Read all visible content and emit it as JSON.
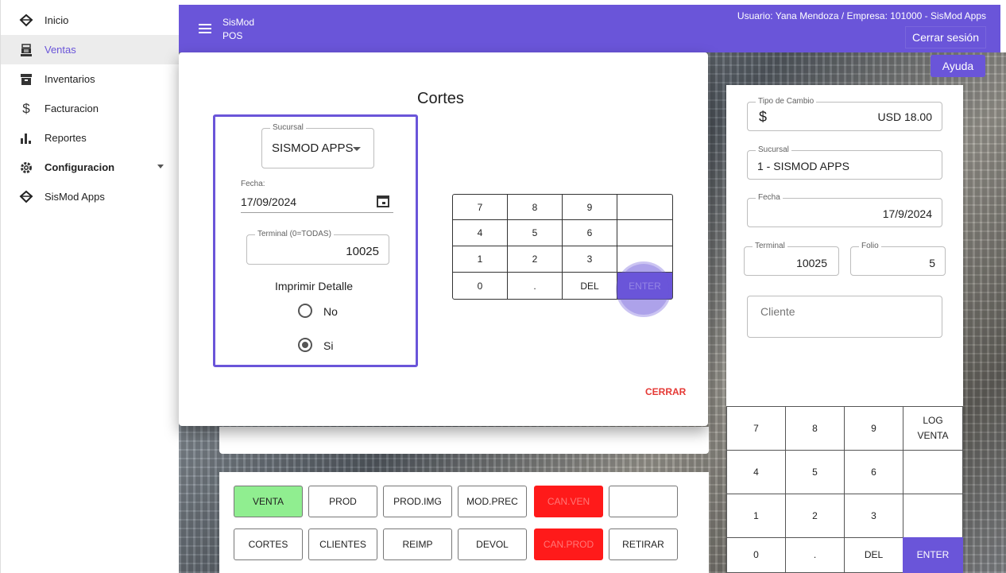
{
  "sidebar": {
    "items": [
      {
        "label": "Inicio",
        "icon": "logo-diamond-icon"
      },
      {
        "label": "Ventas",
        "icon": "cash-register-icon"
      },
      {
        "label": "Inventarios",
        "icon": "archive-icon"
      },
      {
        "label": "Facturacion",
        "icon": "dollar-icon"
      },
      {
        "label": "Reportes",
        "icon": "bar-chart-icon"
      },
      {
        "label": "Configuracion",
        "icon": "gear-icon"
      },
      {
        "label": "SisMod Apps",
        "icon": "logo-diamond-icon"
      }
    ],
    "active": "Ventas"
  },
  "header": {
    "app_name": "SisMod",
    "app_sub": "POS",
    "user_info": "Usuario: Yana Mendoza / Empresa: 101000 - SisMod Apps",
    "logout_label": "Cerrar sesión",
    "help_label": "Ayuda"
  },
  "colors": {
    "accent": "#6a55d9",
    "green_button": "#90ee90",
    "red_button": "#ff1a1a",
    "close_red": "#e53935"
  },
  "dialog": {
    "title": "Cortes",
    "sucursal_label": "Sucursal",
    "sucursal_value": "SISMOD APPS",
    "fecha_label": "Fecha:",
    "fecha_value": "17/09/2024",
    "terminal_label": "Terminal (0=TODAS)",
    "terminal_value": "10025",
    "imprimir_label": "Imprimir Detalle",
    "option_no": "No",
    "option_si": "Si",
    "selected_option": "Si",
    "keypad": [
      "7",
      "8",
      "9",
      "",
      "4",
      "5",
      "6",
      "",
      "1",
      "2",
      "3",
      "",
      "0",
      ".",
      "DEL",
      "ENTER"
    ],
    "close_label": "CERRAR"
  },
  "right_panel": {
    "tipo_cambio_label": "Tipo de Cambio",
    "tipo_cambio_symbol": "$",
    "tipo_cambio_value": "USD  18.00",
    "sucursal_label": "Sucursal",
    "sucursal_value": "1 - SISMOD APPS",
    "fecha_label": "Fecha",
    "fecha_value": "17/9/2024",
    "terminal_label": "Terminal",
    "terminal_value": "10025",
    "folio_label": "Folio",
    "folio_value": "5",
    "cliente_placeholder": "Cliente",
    "keypad": [
      "7",
      "8",
      "9",
      "LOG VENTA",
      "4",
      "5",
      "6",
      "",
      "1",
      "2",
      "3",
      "",
      "0",
      ".",
      "DEL",
      "ENTER"
    ]
  },
  "actions": {
    "row1": [
      "VENTA",
      "PROD",
      "PROD.IMG",
      "MOD.PREC",
      "CAN.VEN",
      ""
    ],
    "row2": [
      "CORTES",
      "CLIENTES",
      "REIMP",
      "DEVOL",
      "CAN.PROD",
      "RETIRAR"
    ]
  }
}
